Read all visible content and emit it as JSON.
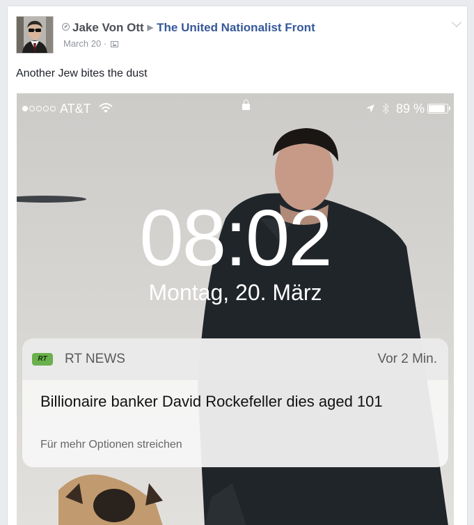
{
  "post": {
    "author": "Jake Von Ott",
    "group": "The United Nationalist Front",
    "date": "March 20 ·",
    "text": "Another Jew bites the dust"
  },
  "icons": [
    "verified-icon",
    "share-arrow-icon",
    "privacy-icon",
    "chevron-down-icon",
    "wifi-icon",
    "lock-icon",
    "location-icon",
    "bluetooth-icon",
    "battery-icon"
  ],
  "phone": {
    "carrier": "AT&T",
    "battery": "89 %",
    "battery_level": 0.89,
    "time": "08:02",
    "date": "Montag, 20. März"
  },
  "notification": {
    "app_logo": "RT",
    "app": "RT NEWS",
    "time": "Vor 2 Min.",
    "title": "Billionaire banker David Rockefeller dies aged 101",
    "hint": "Für mehr Optionen streichen"
  },
  "colors": {
    "link": "#365899",
    "rt_green": "#6ab04c"
  }
}
